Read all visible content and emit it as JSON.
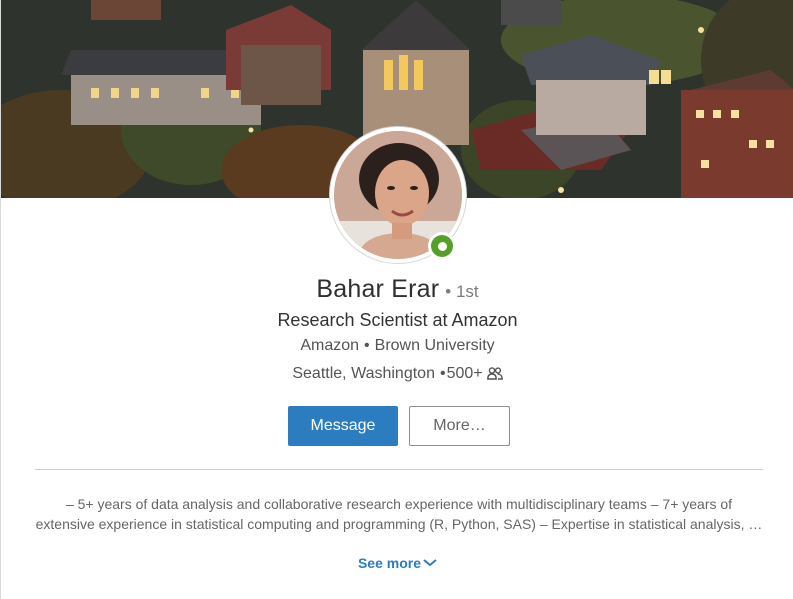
{
  "profile": {
    "name": "Bahar Erar",
    "degree": "• 1st",
    "headline": "Research Scientist at Amazon",
    "company": "Amazon",
    "org_separator": "•",
    "education": "Brown University",
    "location": "Seattle, Washington",
    "location_separator": "•",
    "connections": "500+",
    "online": true
  },
  "actions": {
    "message_label": "Message",
    "more_label": "More…"
  },
  "summary": {
    "line1": "– 5+ years of data analysis and collaborative research experience with multidisciplinary teams – 7+ years of",
    "line2": "extensive experience in statistical computing and programming (R, Python, SAS) – Expertise in statistical analysis, …",
    "see_more_label": "See more"
  },
  "colors": {
    "primary": "#2c7dbf",
    "online": "#56a02a",
    "text": "#333333",
    "muted": "#666666"
  },
  "icons": {
    "connections": "connections-icon",
    "presence": "online-status-icon",
    "see_more": "chevron-down-icon"
  }
}
